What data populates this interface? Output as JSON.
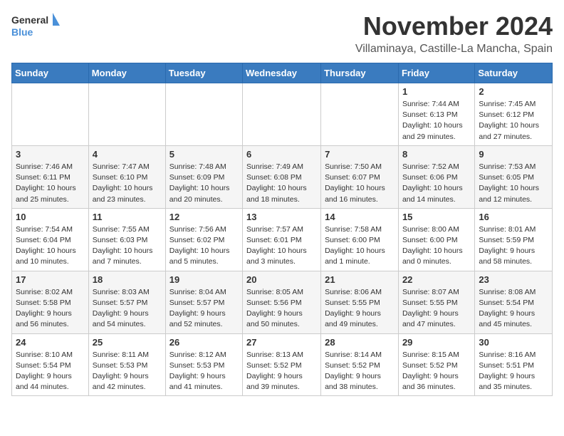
{
  "header": {
    "logo_general": "General",
    "logo_blue": "Blue",
    "month_title": "November 2024",
    "location": "Villaminaya, Castille-La Mancha, Spain"
  },
  "weekdays": [
    "Sunday",
    "Monday",
    "Tuesday",
    "Wednesday",
    "Thursday",
    "Friday",
    "Saturday"
  ],
  "weeks": [
    [
      {
        "day": "",
        "info": ""
      },
      {
        "day": "",
        "info": ""
      },
      {
        "day": "",
        "info": ""
      },
      {
        "day": "",
        "info": ""
      },
      {
        "day": "",
        "info": ""
      },
      {
        "day": "1",
        "info": "Sunrise: 7:44 AM\nSunset: 6:13 PM\nDaylight: 10 hours and 29 minutes."
      },
      {
        "day": "2",
        "info": "Sunrise: 7:45 AM\nSunset: 6:12 PM\nDaylight: 10 hours and 27 minutes."
      }
    ],
    [
      {
        "day": "3",
        "info": "Sunrise: 7:46 AM\nSunset: 6:11 PM\nDaylight: 10 hours and 25 minutes."
      },
      {
        "day": "4",
        "info": "Sunrise: 7:47 AM\nSunset: 6:10 PM\nDaylight: 10 hours and 23 minutes."
      },
      {
        "day": "5",
        "info": "Sunrise: 7:48 AM\nSunset: 6:09 PM\nDaylight: 10 hours and 20 minutes."
      },
      {
        "day": "6",
        "info": "Sunrise: 7:49 AM\nSunset: 6:08 PM\nDaylight: 10 hours and 18 minutes."
      },
      {
        "day": "7",
        "info": "Sunrise: 7:50 AM\nSunset: 6:07 PM\nDaylight: 10 hours and 16 minutes."
      },
      {
        "day": "8",
        "info": "Sunrise: 7:52 AM\nSunset: 6:06 PM\nDaylight: 10 hours and 14 minutes."
      },
      {
        "day": "9",
        "info": "Sunrise: 7:53 AM\nSunset: 6:05 PM\nDaylight: 10 hours and 12 minutes."
      }
    ],
    [
      {
        "day": "10",
        "info": "Sunrise: 7:54 AM\nSunset: 6:04 PM\nDaylight: 10 hours and 10 minutes."
      },
      {
        "day": "11",
        "info": "Sunrise: 7:55 AM\nSunset: 6:03 PM\nDaylight: 10 hours and 7 minutes."
      },
      {
        "day": "12",
        "info": "Sunrise: 7:56 AM\nSunset: 6:02 PM\nDaylight: 10 hours and 5 minutes."
      },
      {
        "day": "13",
        "info": "Sunrise: 7:57 AM\nSunset: 6:01 PM\nDaylight: 10 hours and 3 minutes."
      },
      {
        "day": "14",
        "info": "Sunrise: 7:58 AM\nSunset: 6:00 PM\nDaylight: 10 hours and 1 minute."
      },
      {
        "day": "15",
        "info": "Sunrise: 8:00 AM\nSunset: 6:00 PM\nDaylight: 10 hours and 0 minutes."
      },
      {
        "day": "16",
        "info": "Sunrise: 8:01 AM\nSunset: 5:59 PM\nDaylight: 9 hours and 58 minutes."
      }
    ],
    [
      {
        "day": "17",
        "info": "Sunrise: 8:02 AM\nSunset: 5:58 PM\nDaylight: 9 hours and 56 minutes."
      },
      {
        "day": "18",
        "info": "Sunrise: 8:03 AM\nSunset: 5:57 PM\nDaylight: 9 hours and 54 minutes."
      },
      {
        "day": "19",
        "info": "Sunrise: 8:04 AM\nSunset: 5:57 PM\nDaylight: 9 hours and 52 minutes."
      },
      {
        "day": "20",
        "info": "Sunrise: 8:05 AM\nSunset: 5:56 PM\nDaylight: 9 hours and 50 minutes."
      },
      {
        "day": "21",
        "info": "Sunrise: 8:06 AM\nSunset: 5:55 PM\nDaylight: 9 hours and 49 minutes."
      },
      {
        "day": "22",
        "info": "Sunrise: 8:07 AM\nSunset: 5:55 PM\nDaylight: 9 hours and 47 minutes."
      },
      {
        "day": "23",
        "info": "Sunrise: 8:08 AM\nSunset: 5:54 PM\nDaylight: 9 hours and 45 minutes."
      }
    ],
    [
      {
        "day": "24",
        "info": "Sunrise: 8:10 AM\nSunset: 5:54 PM\nDaylight: 9 hours and 44 minutes."
      },
      {
        "day": "25",
        "info": "Sunrise: 8:11 AM\nSunset: 5:53 PM\nDaylight: 9 hours and 42 minutes."
      },
      {
        "day": "26",
        "info": "Sunrise: 8:12 AM\nSunset: 5:53 PM\nDaylight: 9 hours and 41 minutes."
      },
      {
        "day": "27",
        "info": "Sunrise: 8:13 AM\nSunset: 5:52 PM\nDaylight: 9 hours and 39 minutes."
      },
      {
        "day": "28",
        "info": "Sunrise: 8:14 AM\nSunset: 5:52 PM\nDaylight: 9 hours and 38 minutes."
      },
      {
        "day": "29",
        "info": "Sunrise: 8:15 AM\nSunset: 5:52 PM\nDaylight: 9 hours and 36 minutes."
      },
      {
        "day": "30",
        "info": "Sunrise: 8:16 AM\nSunset: 5:51 PM\nDaylight: 9 hours and 35 minutes."
      }
    ]
  ]
}
